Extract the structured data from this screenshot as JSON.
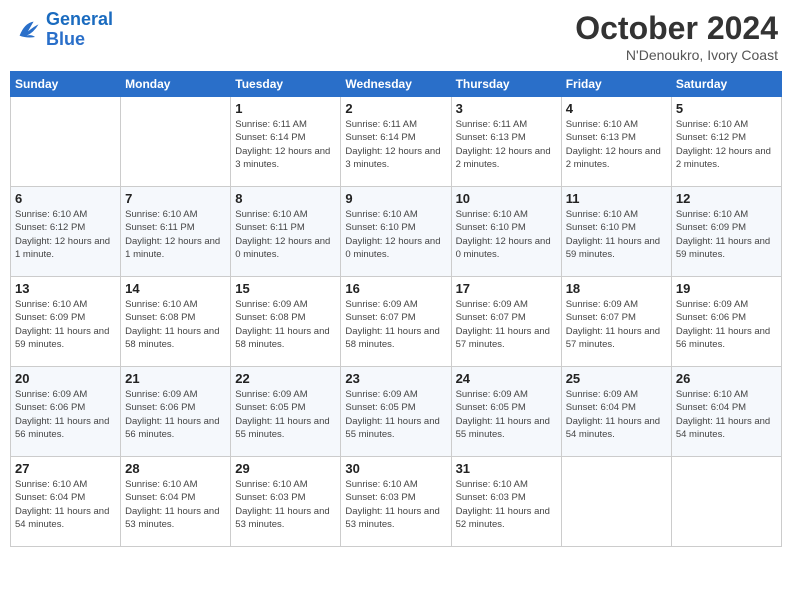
{
  "logo": {
    "text_general": "General",
    "text_blue": "Blue"
  },
  "header": {
    "month": "October 2024",
    "location": "N'Denoukro, Ivory Coast"
  },
  "weekdays": [
    "Sunday",
    "Monday",
    "Tuesday",
    "Wednesday",
    "Thursday",
    "Friday",
    "Saturday"
  ],
  "weeks": [
    [
      {
        "day": "",
        "info": ""
      },
      {
        "day": "",
        "info": ""
      },
      {
        "day": "1",
        "info": "Sunrise: 6:11 AM\nSunset: 6:14 PM\nDaylight: 12 hours and 3 minutes."
      },
      {
        "day": "2",
        "info": "Sunrise: 6:11 AM\nSunset: 6:14 PM\nDaylight: 12 hours and 3 minutes."
      },
      {
        "day": "3",
        "info": "Sunrise: 6:11 AM\nSunset: 6:13 PM\nDaylight: 12 hours and 2 minutes."
      },
      {
        "day": "4",
        "info": "Sunrise: 6:10 AM\nSunset: 6:13 PM\nDaylight: 12 hours and 2 minutes."
      },
      {
        "day": "5",
        "info": "Sunrise: 6:10 AM\nSunset: 6:12 PM\nDaylight: 12 hours and 2 minutes."
      }
    ],
    [
      {
        "day": "6",
        "info": "Sunrise: 6:10 AM\nSunset: 6:12 PM\nDaylight: 12 hours and 1 minute."
      },
      {
        "day": "7",
        "info": "Sunrise: 6:10 AM\nSunset: 6:11 PM\nDaylight: 12 hours and 1 minute."
      },
      {
        "day": "8",
        "info": "Sunrise: 6:10 AM\nSunset: 6:11 PM\nDaylight: 12 hours and 0 minutes."
      },
      {
        "day": "9",
        "info": "Sunrise: 6:10 AM\nSunset: 6:10 PM\nDaylight: 12 hours and 0 minutes."
      },
      {
        "day": "10",
        "info": "Sunrise: 6:10 AM\nSunset: 6:10 PM\nDaylight: 12 hours and 0 minutes."
      },
      {
        "day": "11",
        "info": "Sunrise: 6:10 AM\nSunset: 6:10 PM\nDaylight: 11 hours and 59 minutes."
      },
      {
        "day": "12",
        "info": "Sunrise: 6:10 AM\nSunset: 6:09 PM\nDaylight: 11 hours and 59 minutes."
      }
    ],
    [
      {
        "day": "13",
        "info": "Sunrise: 6:10 AM\nSunset: 6:09 PM\nDaylight: 11 hours and 59 minutes."
      },
      {
        "day": "14",
        "info": "Sunrise: 6:10 AM\nSunset: 6:08 PM\nDaylight: 11 hours and 58 minutes."
      },
      {
        "day": "15",
        "info": "Sunrise: 6:09 AM\nSunset: 6:08 PM\nDaylight: 11 hours and 58 minutes."
      },
      {
        "day": "16",
        "info": "Sunrise: 6:09 AM\nSunset: 6:07 PM\nDaylight: 11 hours and 58 minutes."
      },
      {
        "day": "17",
        "info": "Sunrise: 6:09 AM\nSunset: 6:07 PM\nDaylight: 11 hours and 57 minutes."
      },
      {
        "day": "18",
        "info": "Sunrise: 6:09 AM\nSunset: 6:07 PM\nDaylight: 11 hours and 57 minutes."
      },
      {
        "day": "19",
        "info": "Sunrise: 6:09 AM\nSunset: 6:06 PM\nDaylight: 11 hours and 56 minutes."
      }
    ],
    [
      {
        "day": "20",
        "info": "Sunrise: 6:09 AM\nSunset: 6:06 PM\nDaylight: 11 hours and 56 minutes."
      },
      {
        "day": "21",
        "info": "Sunrise: 6:09 AM\nSunset: 6:06 PM\nDaylight: 11 hours and 56 minutes."
      },
      {
        "day": "22",
        "info": "Sunrise: 6:09 AM\nSunset: 6:05 PM\nDaylight: 11 hours and 55 minutes."
      },
      {
        "day": "23",
        "info": "Sunrise: 6:09 AM\nSunset: 6:05 PM\nDaylight: 11 hours and 55 minutes."
      },
      {
        "day": "24",
        "info": "Sunrise: 6:09 AM\nSunset: 6:05 PM\nDaylight: 11 hours and 55 minutes."
      },
      {
        "day": "25",
        "info": "Sunrise: 6:09 AM\nSunset: 6:04 PM\nDaylight: 11 hours and 54 minutes."
      },
      {
        "day": "26",
        "info": "Sunrise: 6:10 AM\nSunset: 6:04 PM\nDaylight: 11 hours and 54 minutes."
      }
    ],
    [
      {
        "day": "27",
        "info": "Sunrise: 6:10 AM\nSunset: 6:04 PM\nDaylight: 11 hours and 54 minutes."
      },
      {
        "day": "28",
        "info": "Sunrise: 6:10 AM\nSunset: 6:04 PM\nDaylight: 11 hours and 53 minutes."
      },
      {
        "day": "29",
        "info": "Sunrise: 6:10 AM\nSunset: 6:03 PM\nDaylight: 11 hours and 53 minutes."
      },
      {
        "day": "30",
        "info": "Sunrise: 6:10 AM\nSunset: 6:03 PM\nDaylight: 11 hours and 53 minutes."
      },
      {
        "day": "31",
        "info": "Sunrise: 6:10 AM\nSunset: 6:03 PM\nDaylight: 11 hours and 52 minutes."
      },
      {
        "day": "",
        "info": ""
      },
      {
        "day": "",
        "info": ""
      }
    ]
  ]
}
